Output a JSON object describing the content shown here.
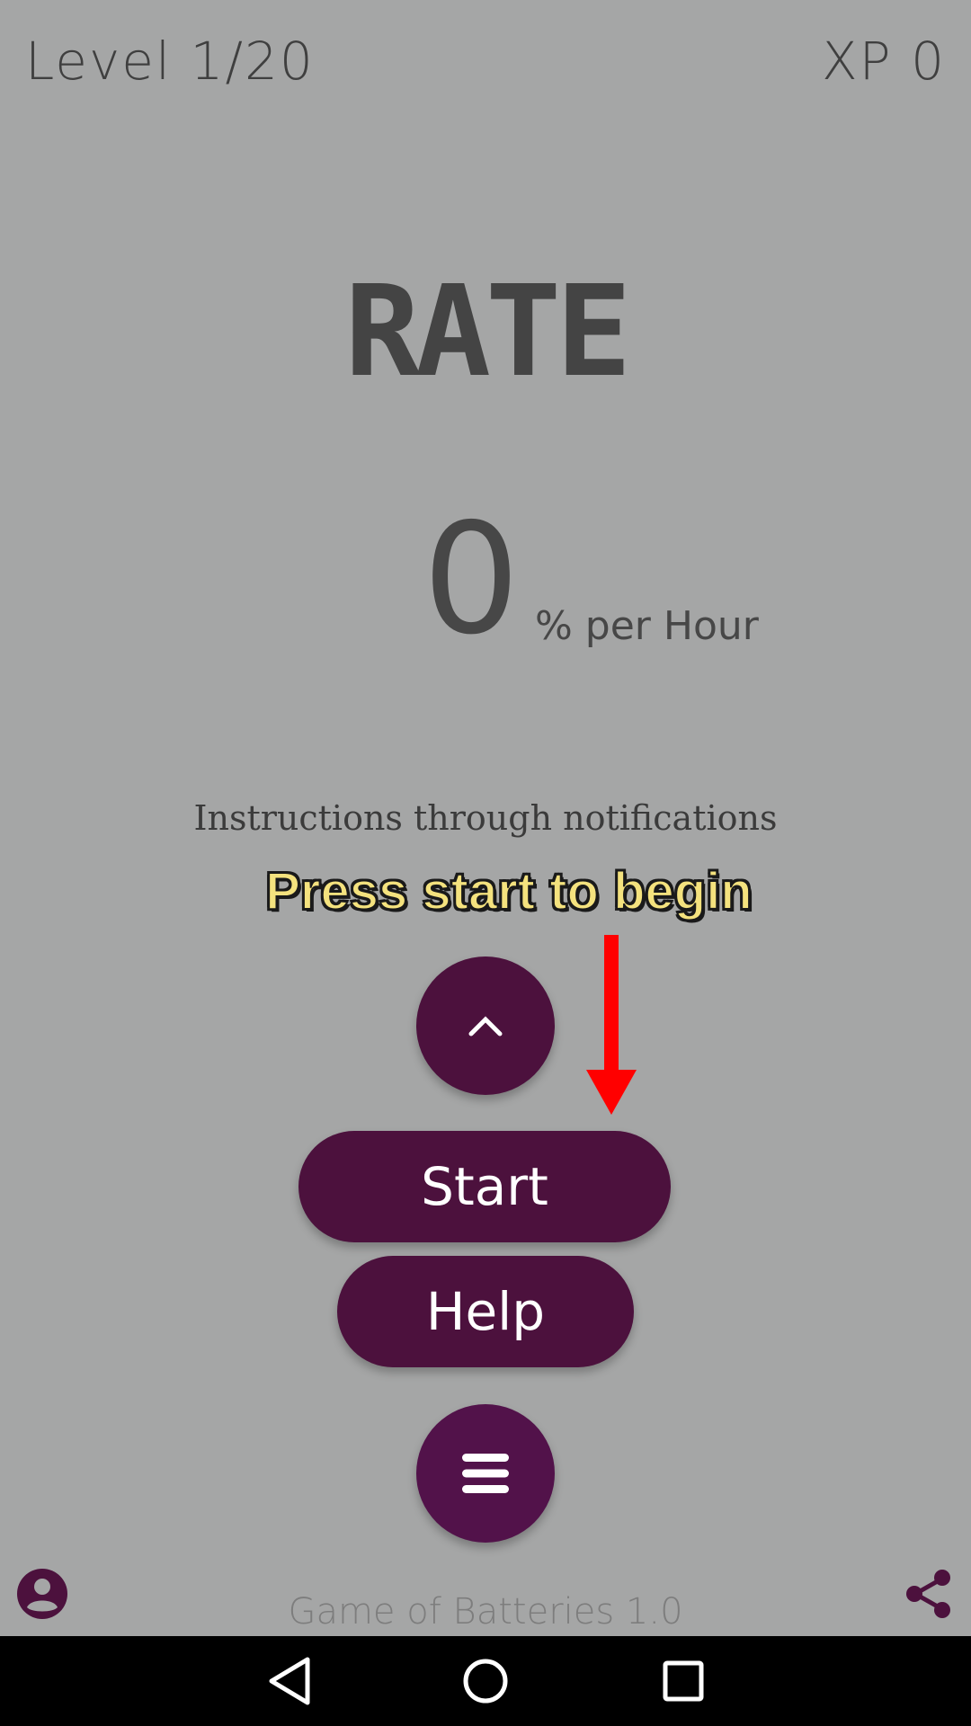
{
  "header": {
    "level_label": "Level 1/20",
    "xp_label": "XP 0"
  },
  "main": {
    "title": "RATE",
    "rate_value": "0",
    "rate_unit": "% per Hour",
    "instructions": "Instructions through notifications",
    "hint": "Press start to begin"
  },
  "buttons": {
    "up_icon": "chevron-up-icon",
    "start_label": "Start",
    "help_label": "Help",
    "menu_icon": "hamburger-menu-icon"
  },
  "footer": {
    "app_version": "Game of Batteries 1.0",
    "profile_icon": "account-circle-icon",
    "share_icon": "share-icon"
  },
  "navbar": {
    "back_icon": "back-triangle-icon",
    "home_icon": "home-circle-icon",
    "recent_icon": "recent-apps-square-icon"
  },
  "colors": {
    "background": "#a5a6a6",
    "button": "#4c113d",
    "hint_text": "#f4e27e",
    "arrow": "#ff0000"
  }
}
